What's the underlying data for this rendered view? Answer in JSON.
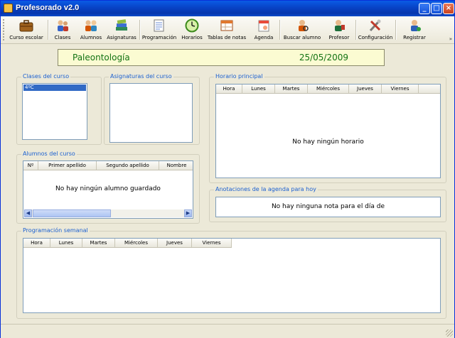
{
  "window": {
    "title": "Profesorado v2.0",
    "controls": {
      "minimize": "_",
      "maximize": "□",
      "close": "×"
    }
  },
  "toolbar": {
    "items": [
      {
        "label": "Curso escolar",
        "icon": "briefcase-icon"
      },
      {
        "label": "Clases",
        "icon": "class-group-icon"
      },
      {
        "label": "Alumnos",
        "icon": "students-icon"
      },
      {
        "label": "Asignaturas",
        "icon": "books-icon"
      },
      {
        "label": "Programación",
        "icon": "programming-doc-icon"
      },
      {
        "label": "Horarios",
        "icon": "clock-icon"
      },
      {
        "label": "Tablas de notas",
        "icon": "grades-table-icon"
      },
      {
        "label": "Agenda",
        "icon": "calendar-icon"
      },
      {
        "label": "Buscar alumno",
        "icon": "search-student-icon"
      },
      {
        "label": "Profesor",
        "icon": "teacher-icon"
      },
      {
        "label": "Configuración",
        "icon": "tools-icon"
      },
      {
        "label": "Registrar",
        "icon": "register-user-icon"
      }
    ],
    "overflow": "»"
  },
  "banner": {
    "subject": "Paleontología",
    "date": "25/05/2009"
  },
  "clases": {
    "legend": "Clases del curso",
    "items": [
      "4ºC"
    ]
  },
  "asignaturas": {
    "legend": "Asignaturas del curso"
  },
  "alumnos": {
    "legend": "Alumnos del curso",
    "columns": [
      "Nº",
      "Primer apellido",
      "Segundo apellido",
      "Nombre"
    ],
    "empty": "No hay ningún alumno guardado"
  },
  "horario": {
    "legend": "Horario principal",
    "columns": [
      "Hora",
      "Lunes",
      "Martes",
      "Miércoles",
      "Jueves",
      "Viernes"
    ],
    "empty": "No hay ningún horario"
  },
  "agenda": {
    "legend": "Anotaciones de la agenda para hoy",
    "empty": "No hay ninguna nota para el día de"
  },
  "programacion": {
    "legend": "Programación semanal",
    "columns": [
      "Hora",
      "Lunes",
      "Martes",
      "Miércoles",
      "Jueves",
      "Viernes"
    ]
  },
  "colors": {
    "titlebar": "#0842c5",
    "legend": "#1a5fd0",
    "banner_text": "#137313",
    "banner_bg": "#fbfbd2"
  }
}
